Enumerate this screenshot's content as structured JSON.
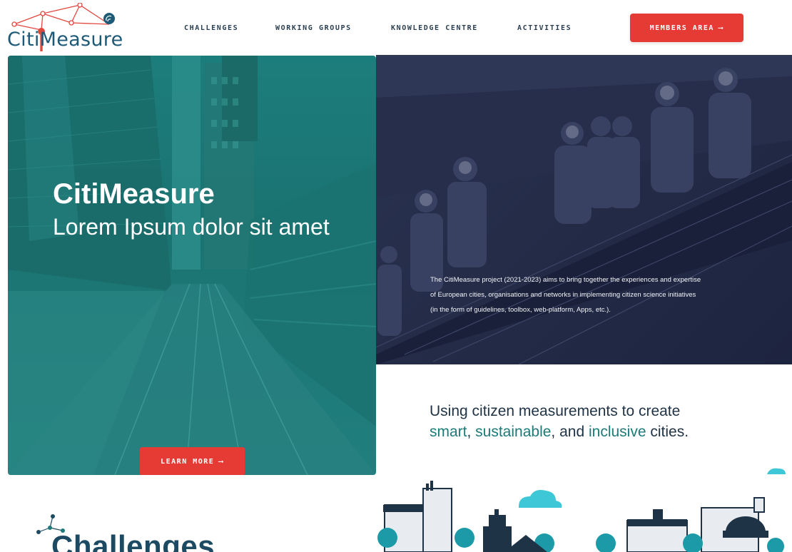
{
  "header": {
    "logo_text": "CitiMeasure",
    "nav": [
      {
        "label": "CHALLENGES"
      },
      {
        "label": "WORKING GROUPS"
      },
      {
        "label": "KNOWLEDGE CENTRE"
      },
      {
        "label": "ACTIVITIES"
      }
    ],
    "members_button": "MEMBERS AREA",
    "arrow": "⟶"
  },
  "hero": {
    "title": "CitiMeasure",
    "subtitle": "Lorem Ipsum dolor sit amet",
    "learn_more": "LEARN MORE",
    "description": "The CitiMeasure project (2021-2023) aims to bring together the experiences and expertise of European cities, organisations and networks in implementing citizen science initiatives (in the form of guidelines, toolbox, web-platform, Apps, etc.)."
  },
  "tagline": {
    "line1": "Using citizen measurements to create",
    "smart": "smart",
    "comma1": ", ",
    "sustainable": "sustainable",
    "and": ", and ",
    "inclusive": "inclusive",
    "end": " cities."
  },
  "challenges": {
    "title": "Challenges"
  },
  "colors": {
    "accent_red": "#e63a35",
    "teal": "#1c7b78",
    "navy": "#1f3346"
  }
}
